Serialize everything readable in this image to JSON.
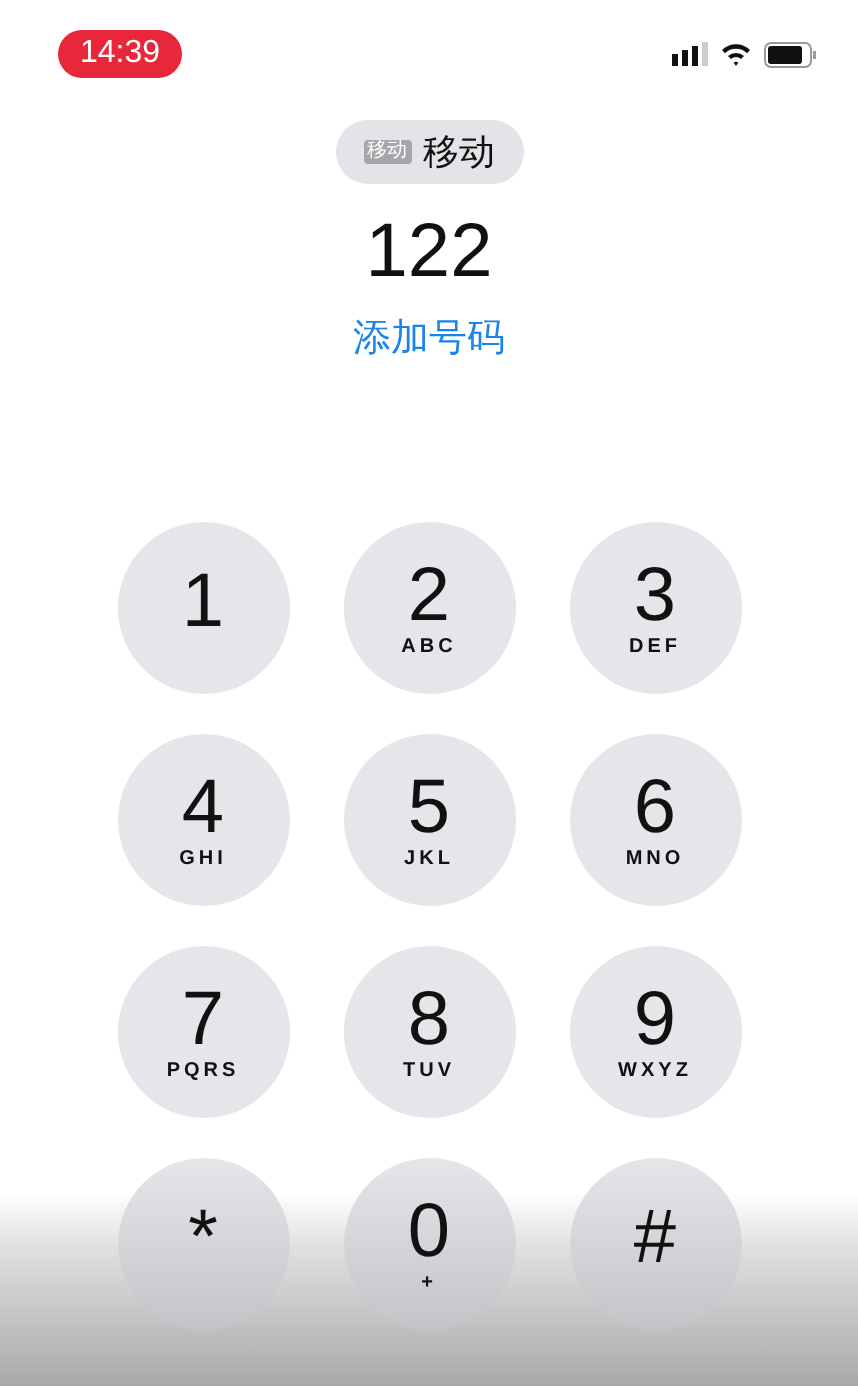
{
  "status_bar": {
    "time": "14:39"
  },
  "carrier": {
    "badge": "移动",
    "name": "移动"
  },
  "number": "122",
  "add_number_link": "添加号码",
  "keypad": [
    {
      "digit": "1"
    },
    {
      "digit": "2",
      "letters": "ABC"
    },
    {
      "digit": "3",
      "letters": "DEF"
    },
    {
      "digit": "4",
      "letters": "GHI"
    },
    {
      "digit": "5",
      "letters": "JKL"
    },
    {
      "digit": "6",
      "letters": "MNO"
    },
    {
      "digit": "7",
      "letters": "PQRS"
    },
    {
      "digit": "8",
      "letters": "TUV"
    },
    {
      "digit": "9",
      "letters": "WXYZ"
    },
    {
      "digit": "*"
    },
    {
      "digit": "0",
      "letters": "+"
    },
    {
      "digit": "#"
    }
  ]
}
